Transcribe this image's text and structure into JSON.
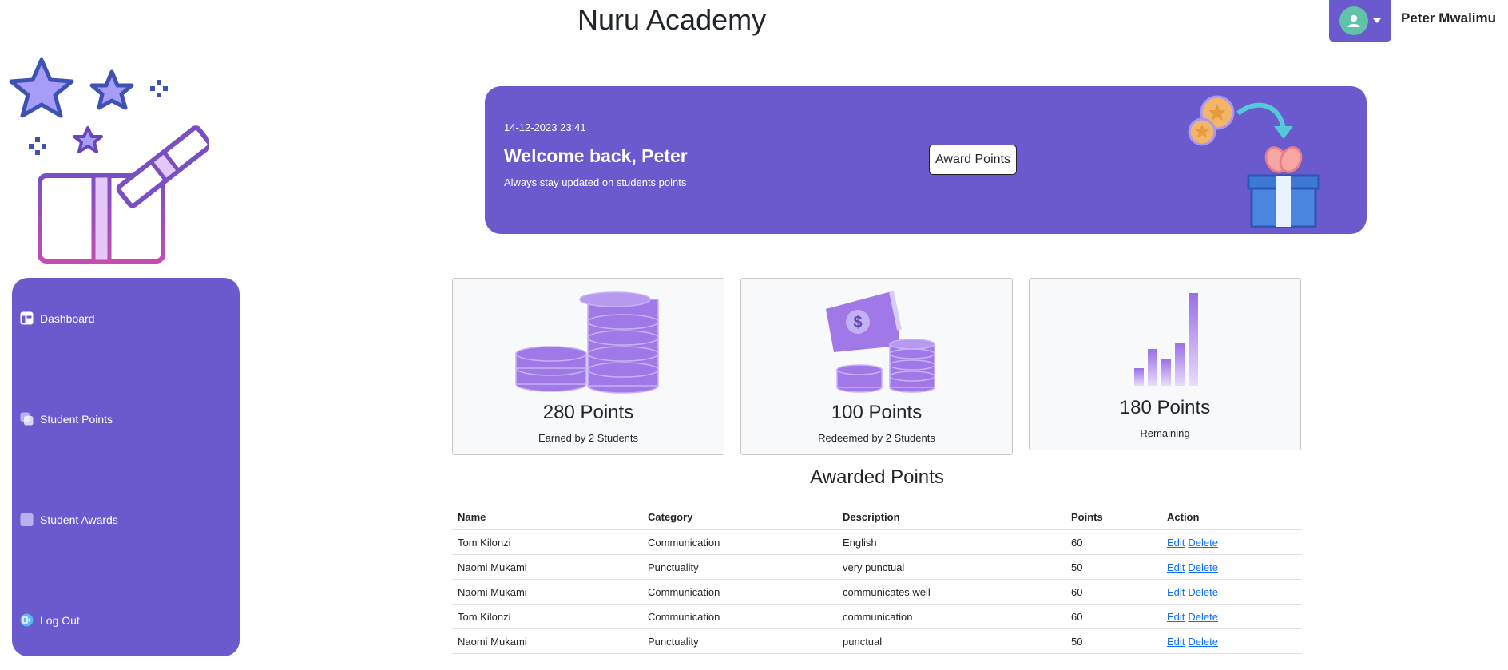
{
  "header": {
    "app_title": "Nuru Academy",
    "user_name": "Peter Mwalimu"
  },
  "sidebar": {
    "items": [
      {
        "label": "Dashboard",
        "icon": "dashboard-icon"
      },
      {
        "label": "Student Points",
        "icon": "layers-icon"
      },
      {
        "label": "Student Awards",
        "icon": "square-icon"
      },
      {
        "label": "Log Out",
        "icon": "logout-icon"
      }
    ]
  },
  "banner": {
    "datetime": "14-12-2023 23:41",
    "welcome": "Welcome back, Peter",
    "subtitle": "Always stay updated on students points",
    "award_button": "Award Points"
  },
  "stats": [
    {
      "value": "280 Points",
      "caption": "Earned by 2 Students",
      "icon": "coin-stack-icon"
    },
    {
      "value": "100 Points",
      "caption": "Redeemed by 2 Students",
      "icon": "money-coins-icon"
    },
    {
      "value": "180 Points",
      "caption": "Remaining",
      "icon": "bar-growth-icon"
    }
  ],
  "table": {
    "title": "Awarded Points",
    "columns": [
      "Name",
      "Category",
      "Description",
      "Points",
      "Action"
    ],
    "rows": [
      {
        "name": "Tom Kilonzi",
        "category": "Communication",
        "description": "English",
        "points": "60"
      },
      {
        "name": "Naomi Mukami",
        "category": "Punctuality",
        "description": "very punctual",
        "points": "50"
      },
      {
        "name": "Naomi Mukami",
        "category": "Communication",
        "description": "communicates well",
        "points": "60"
      },
      {
        "name": "Tom Kilonzi",
        "category": "Communication",
        "description": "communication",
        "points": "60"
      },
      {
        "name": "Naomi Mukami",
        "category": "Punctuality",
        "description": "punctual",
        "points": "50"
      }
    ],
    "edit_label": "Edit",
    "delete_label": "Delete"
  },
  "colors": {
    "accent": "#6a5acd",
    "link": "#0d6efd",
    "avatar": "#5fc4a7"
  }
}
